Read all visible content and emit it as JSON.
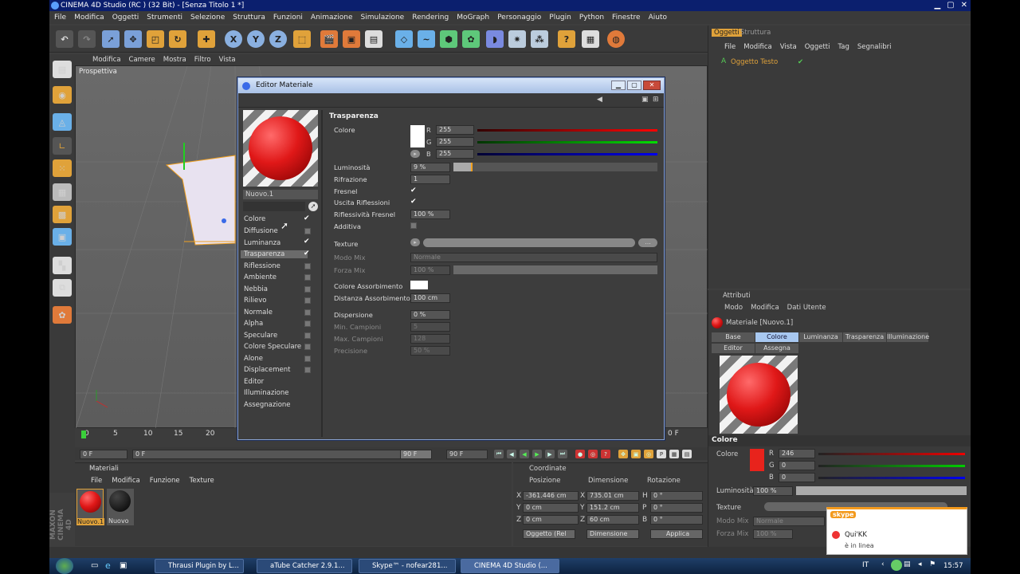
{
  "window": {
    "title": "CINEMA 4D Studio (RC ) (32 Bit) - [Senza Titolo 1 *]"
  },
  "menu": [
    "File",
    "Modifica",
    "Oggetti",
    "Strumenti",
    "Selezione",
    "Struttura",
    "Funzioni",
    "Animazione",
    "Simulazione",
    "Rendering",
    "MoGraph",
    "Personaggio",
    "Plugin",
    "Python",
    "Finestre",
    "Aiuto"
  ],
  "viewport": {
    "menu": [
      "Modifica",
      "Camere",
      "Mostra",
      "Filtro",
      "Vista"
    ],
    "label": "Prospettiva"
  },
  "timeline": {
    "ticks": [
      "0",
      "5",
      "10",
      "15",
      "20"
    ],
    "right_tick": "0 F",
    "frame_start": "0 F",
    "frame_field": "0 F",
    "frame_end": "90 F",
    "frame_end2": "90 F"
  },
  "materials": {
    "title": "Materiali",
    "menu": [
      "File",
      "Modifica",
      "Funzione",
      "Texture"
    ],
    "items": [
      "Nuovo.1",
      "Nuovo"
    ]
  },
  "coords": {
    "title": "Coordinate",
    "headers": [
      "Posizione",
      "Dimensione",
      "Rotazione"
    ],
    "rows": [
      {
        "a": "X",
        "p": "-361.446 cm",
        "b": "X",
        "d": "735.01 cm",
        "c": "H",
        "r": "0 °"
      },
      {
        "a": "Y",
        "p": "0 cm",
        "b": "Y",
        "d": "151.2 cm",
        "c": "P",
        "r": "0 °"
      },
      {
        "a": "Z",
        "p": "0 cm",
        "b": "Z",
        "d": "60 cm",
        "c": "B",
        "r": "0 °"
      }
    ],
    "mode1": "Oggetto (Rel",
    "mode2": "Dimensione",
    "apply": "Applica"
  },
  "objects": {
    "tabs": [
      "Oggetti",
      "Struttura"
    ],
    "menu": [
      "File",
      "Modifica",
      "Vista",
      "Oggetti",
      "Tag",
      "Segnalibri"
    ],
    "item": "Oggetto Testo"
  },
  "attributes": {
    "title": "Attributi",
    "menu": [
      "Modo",
      "Modifica",
      "Dati Utente"
    ],
    "material": "Materiale [Nuovo.1]",
    "tabs": [
      "Base",
      "Colore",
      "Luminanza",
      "Trasparenza",
      "Illuminazione",
      "Editor",
      "Assegna"
    ],
    "section": "Colore",
    "color_label": "Colore",
    "r": "246",
    "g": "0",
    "b": "0",
    "lum_label": "Luminosità",
    "lum": "100 %",
    "tex_label": "Texture",
    "mix_label": "Modo Mix",
    "mix": "Normale",
    "force_label": "Forza Mix",
    "force": "100 %",
    "swatch": "#e8231c"
  },
  "editor": {
    "title": "Editor Materiale",
    "name": "Nuovo.1",
    "section": "Trasparenza",
    "channels": [
      "Colore",
      "Diffusione",
      "Luminanza",
      "Trasparenza",
      "Riflessione",
      "Ambiente",
      "Nebbia",
      "Rilievo",
      "Normale",
      "Alpha",
      "Speculare",
      "Colore Speculare",
      "Alone",
      "Displacement",
      "Editor",
      "Illuminazione",
      "Assegnazione"
    ],
    "checked": [
      true,
      false,
      true,
      true,
      false,
      false,
      false,
      false,
      false,
      false,
      false,
      false,
      false,
      false
    ],
    "color_label": "Colore",
    "r": "255",
    "g": "255",
    "b": "255",
    "lum_label": "Luminosità",
    "lum": "9 %",
    "refr_label": "Rifrazione",
    "refr": "1",
    "fresnel_label": "Fresnel",
    "exit_label": "Uscita Riflessioni",
    "fresrefl_label": "Riflessività Fresnel",
    "fresrefl": "100 %",
    "add_label": "Additiva",
    "tex_label": "Texture",
    "mix_label": "Modo Mix",
    "mix": "Normale",
    "force_label": "Forza Mix",
    "force": "100 %",
    "abs_label": "Colore Assorbimento",
    "dist_label": "Distanza Assorbimento",
    "dist": "100 cm",
    "disp_label": "Dispersione",
    "disp": "0 %",
    "minc_label": "Min. Campioni",
    "minc": "5",
    "maxc_label": "Max. Campioni",
    "maxc": "128",
    "prec_label": "Precisione",
    "prec": "50 %"
  },
  "notification": {
    "app": "skype",
    "name": "Qui'KK",
    "status": "è in linea"
  },
  "taskbar": {
    "items": [
      "Thrausi Plugin by L...",
      "aTube Catcher 2.9.1...",
      "Skype™ - nofear281...",
      "CINEMA 4D Studio (..."
    ],
    "lang": "IT",
    "time": "15:57"
  }
}
